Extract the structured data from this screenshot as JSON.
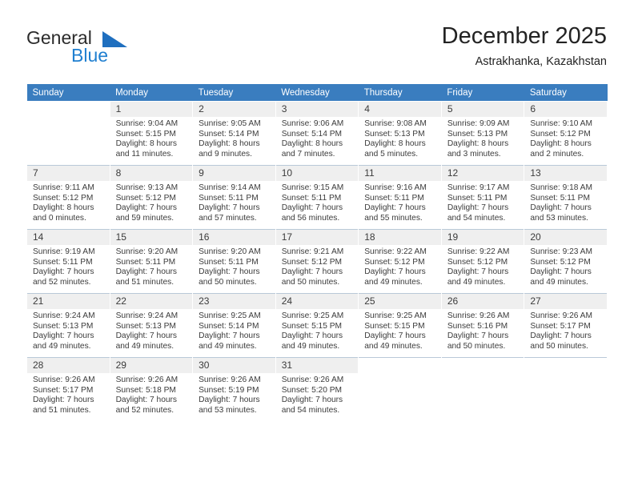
{
  "brand": {
    "name_part1": "General",
    "name_part2": "Blue",
    "flag_icon": "triangle-flag-icon"
  },
  "header": {
    "title": "December 2025",
    "subtitle": "Astrakhanka, Kazakhstan"
  },
  "colors": {
    "header_blue": "#3a7dbf",
    "brand_blue": "#1f7fd0",
    "daynum_bg": "#efefef",
    "row_divider": "#b9c9d8",
    "text": "#3b3b3b"
  },
  "weekdays": [
    "Sunday",
    "Monday",
    "Tuesday",
    "Wednesday",
    "Thursday",
    "Friday",
    "Saturday"
  ],
  "weeks": [
    [
      {
        "day": "",
        "lines": []
      },
      {
        "day": "1",
        "lines": [
          "Sunrise: 9:04 AM",
          "Sunset: 5:15 PM",
          "Daylight: 8 hours",
          "and 11 minutes."
        ]
      },
      {
        "day": "2",
        "lines": [
          "Sunrise: 9:05 AM",
          "Sunset: 5:14 PM",
          "Daylight: 8 hours",
          "and 9 minutes."
        ]
      },
      {
        "day": "3",
        "lines": [
          "Sunrise: 9:06 AM",
          "Sunset: 5:14 PM",
          "Daylight: 8 hours",
          "and 7 minutes."
        ]
      },
      {
        "day": "4",
        "lines": [
          "Sunrise: 9:08 AM",
          "Sunset: 5:13 PM",
          "Daylight: 8 hours",
          "and 5 minutes."
        ]
      },
      {
        "day": "5",
        "lines": [
          "Sunrise: 9:09 AM",
          "Sunset: 5:13 PM",
          "Daylight: 8 hours",
          "and 3 minutes."
        ]
      },
      {
        "day": "6",
        "lines": [
          "Sunrise: 9:10 AM",
          "Sunset: 5:12 PM",
          "Daylight: 8 hours",
          "and 2 minutes."
        ]
      }
    ],
    [
      {
        "day": "7",
        "lines": [
          "Sunrise: 9:11 AM",
          "Sunset: 5:12 PM",
          "Daylight: 8 hours",
          "and 0 minutes."
        ]
      },
      {
        "day": "8",
        "lines": [
          "Sunrise: 9:13 AM",
          "Sunset: 5:12 PM",
          "Daylight: 7 hours",
          "and 59 minutes."
        ]
      },
      {
        "day": "9",
        "lines": [
          "Sunrise: 9:14 AM",
          "Sunset: 5:11 PM",
          "Daylight: 7 hours",
          "and 57 minutes."
        ]
      },
      {
        "day": "10",
        "lines": [
          "Sunrise: 9:15 AM",
          "Sunset: 5:11 PM",
          "Daylight: 7 hours",
          "and 56 minutes."
        ]
      },
      {
        "day": "11",
        "lines": [
          "Sunrise: 9:16 AM",
          "Sunset: 5:11 PM",
          "Daylight: 7 hours",
          "and 55 minutes."
        ]
      },
      {
        "day": "12",
        "lines": [
          "Sunrise: 9:17 AM",
          "Sunset: 5:11 PM",
          "Daylight: 7 hours",
          "and 54 minutes."
        ]
      },
      {
        "day": "13",
        "lines": [
          "Sunrise: 9:18 AM",
          "Sunset: 5:11 PM",
          "Daylight: 7 hours",
          "and 53 minutes."
        ]
      }
    ],
    [
      {
        "day": "14",
        "lines": [
          "Sunrise: 9:19 AM",
          "Sunset: 5:11 PM",
          "Daylight: 7 hours",
          "and 52 minutes."
        ]
      },
      {
        "day": "15",
        "lines": [
          "Sunrise: 9:20 AM",
          "Sunset: 5:11 PM",
          "Daylight: 7 hours",
          "and 51 minutes."
        ]
      },
      {
        "day": "16",
        "lines": [
          "Sunrise: 9:20 AM",
          "Sunset: 5:11 PM",
          "Daylight: 7 hours",
          "and 50 minutes."
        ]
      },
      {
        "day": "17",
        "lines": [
          "Sunrise: 9:21 AM",
          "Sunset: 5:12 PM",
          "Daylight: 7 hours",
          "and 50 minutes."
        ]
      },
      {
        "day": "18",
        "lines": [
          "Sunrise: 9:22 AM",
          "Sunset: 5:12 PM",
          "Daylight: 7 hours",
          "and 49 minutes."
        ]
      },
      {
        "day": "19",
        "lines": [
          "Sunrise: 9:22 AM",
          "Sunset: 5:12 PM",
          "Daylight: 7 hours",
          "and 49 minutes."
        ]
      },
      {
        "day": "20",
        "lines": [
          "Sunrise: 9:23 AM",
          "Sunset: 5:12 PM",
          "Daylight: 7 hours",
          "and 49 minutes."
        ]
      }
    ],
    [
      {
        "day": "21",
        "lines": [
          "Sunrise: 9:24 AM",
          "Sunset: 5:13 PM",
          "Daylight: 7 hours",
          "and 49 minutes."
        ]
      },
      {
        "day": "22",
        "lines": [
          "Sunrise: 9:24 AM",
          "Sunset: 5:13 PM",
          "Daylight: 7 hours",
          "and 49 minutes."
        ]
      },
      {
        "day": "23",
        "lines": [
          "Sunrise: 9:25 AM",
          "Sunset: 5:14 PM",
          "Daylight: 7 hours",
          "and 49 minutes."
        ]
      },
      {
        "day": "24",
        "lines": [
          "Sunrise: 9:25 AM",
          "Sunset: 5:15 PM",
          "Daylight: 7 hours",
          "and 49 minutes."
        ]
      },
      {
        "day": "25",
        "lines": [
          "Sunrise: 9:25 AM",
          "Sunset: 5:15 PM",
          "Daylight: 7 hours",
          "and 49 minutes."
        ]
      },
      {
        "day": "26",
        "lines": [
          "Sunrise: 9:26 AM",
          "Sunset: 5:16 PM",
          "Daylight: 7 hours",
          "and 50 minutes."
        ]
      },
      {
        "day": "27",
        "lines": [
          "Sunrise: 9:26 AM",
          "Sunset: 5:17 PM",
          "Daylight: 7 hours",
          "and 50 minutes."
        ]
      }
    ],
    [
      {
        "day": "28",
        "lines": [
          "Sunrise: 9:26 AM",
          "Sunset: 5:17 PM",
          "Daylight: 7 hours",
          "and 51 minutes."
        ]
      },
      {
        "day": "29",
        "lines": [
          "Sunrise: 9:26 AM",
          "Sunset: 5:18 PM",
          "Daylight: 7 hours",
          "and 52 minutes."
        ]
      },
      {
        "day": "30",
        "lines": [
          "Sunrise: 9:26 AM",
          "Sunset: 5:19 PM",
          "Daylight: 7 hours",
          "and 53 minutes."
        ]
      },
      {
        "day": "31",
        "lines": [
          "Sunrise: 9:26 AM",
          "Sunset: 5:20 PM",
          "Daylight: 7 hours",
          "and 54 minutes."
        ]
      },
      {
        "day": "",
        "lines": []
      },
      {
        "day": "",
        "lines": []
      },
      {
        "day": "",
        "lines": []
      }
    ]
  ]
}
